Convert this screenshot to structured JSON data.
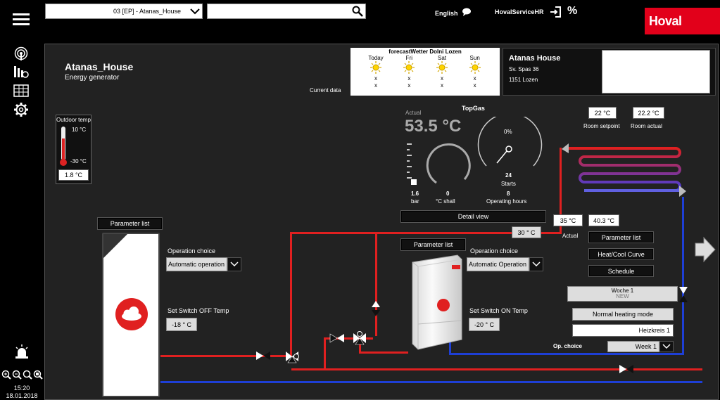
{
  "header": {
    "site_select": "03 [EP] - Atanas_House",
    "search_placeholder": "",
    "language": "English",
    "user": "HovalServiceHR",
    "brand": "Hoval"
  },
  "colors": {
    "brand_red": "#e2001a",
    "pipe_red": "#e02020",
    "pipe_blue": "#1e3fd6",
    "panel_bg": "#222222"
  },
  "sidebar": {
    "time": "15:20",
    "date": "18.01.2018"
  },
  "site": {
    "name": "Atanas_House",
    "subtitle": "Energy generator"
  },
  "forecast": {
    "title": "forecastWetter Dolni Lozen",
    "current_label": "Current data",
    "days": [
      {
        "day": "Today",
        "v1": "x",
        "v2": "x"
      },
      {
        "day": "Fri",
        "v1": "x",
        "v2": "x"
      },
      {
        "day": "Sat",
        "v1": "x",
        "v2": "x"
      },
      {
        "day": "Sun",
        "v1": "x",
        "v2": "x"
      }
    ]
  },
  "address": {
    "name": "Atanas House",
    "street": "Sv. Spas 36",
    "city": "1151 Lozen"
  },
  "outdoor": {
    "label": "Outdoor temp",
    "max": "10 °C",
    "min": "-30 °C",
    "value": "1.8 °C"
  },
  "topgas": {
    "title": "TopGas",
    "actual_label": "Actual",
    "actual_value": "53.5 °C",
    "percent": "0%",
    "pressure": "1.6",
    "pressure_unit": "bar",
    "setpoint": "0",
    "setpoint_unit": "°C shall",
    "starts": "24",
    "starts_label": "Starts",
    "hours": "8",
    "hours_label": "Operating hours",
    "detail_button": "Detail view"
  },
  "room": {
    "setpoint_value": "22 °C",
    "setpoint_label": "Room setpoint",
    "actual_value": "22.2 °C",
    "actual_label": "Room actual"
  },
  "circuit": {
    "flow_actual": "35 °C",
    "flow_actual_label": "Actual",
    "flow_target": "40.3 °C",
    "return_temp": "30 ° C",
    "param_button": "Parameter list",
    "curve_button": "Heat/Cool Curve",
    "schedule_button": "Schedule",
    "week_title": "Woche 1",
    "week_sub": "NEW",
    "mode": "Normal heating mode",
    "name": "Heizkreis 1",
    "op_choice_label": "Op. choice",
    "op_choice_value": "Week 1"
  },
  "left_unit": {
    "param_button": "Parameter list",
    "op_label": "Operation choice",
    "op_value": "Automatic operation",
    "switch_label": "Set Switch OFF Temp",
    "switch_value": "-18 ° C"
  },
  "boiler": {
    "param_button": "Parameter list",
    "op_label": "Operation choice",
    "op_value": "Automatic Operation",
    "switch_label": "Set Switch ON Temp",
    "switch_value": "-20 ° C"
  }
}
